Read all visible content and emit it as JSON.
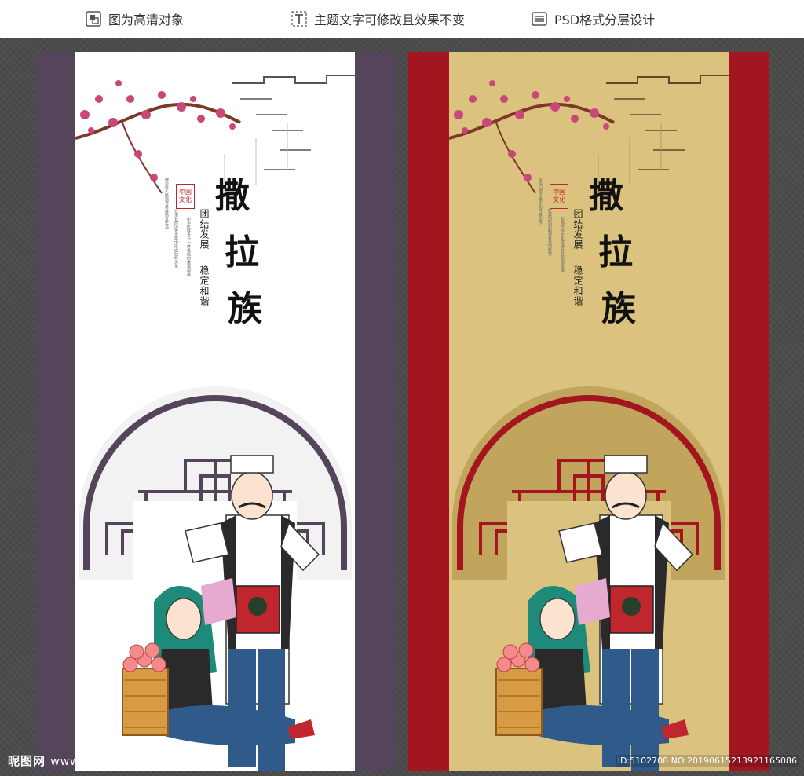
{
  "toolbar": {
    "item1": {
      "label": "图为高清对象",
      "icon": "image-icon"
    },
    "item2": {
      "label": "主题文字可修改且效果不变",
      "icon": "text-icon"
    },
    "item3": {
      "label": "PSD格式分层设计",
      "icon": "layers-icon"
    }
  },
  "poster": {
    "title_chars": [
      "撒",
      "拉",
      "族"
    ],
    "slogan_1": "团结发展",
    "slogan_2": "稳定和谐",
    "stamp_lines": [
      "中国",
      "文化"
    ],
    "body_columns": [
      "撒拉族人民勤劳勇敢热爱生活",
      "在漫长的历史发展中形成独特文化",
      "中华民族多元一体格局的重要组成",
      "风俗习惯丰富多彩传承至今",
      "民族团结和睦相处共同繁荣",
      "弘扬传统文化促进社会和谐发展"
    ]
  },
  "variants": [
    {
      "name": "white-purple",
      "bg": "#ffffff",
      "side": "#54455a",
      "arch": "#54455a",
      "arch_bg": "#f2f2f2"
    },
    {
      "name": "gold-red",
      "bg": "#dcc27f",
      "side": "#a3161f",
      "arch": "#a3161f",
      "arch_bg": "#c2a55c"
    }
  ],
  "watermark": {
    "brand": "昵图网",
    "url": "www.nipic.com",
    "id_text": "ID:5102708 NO:20190615213921165086"
  }
}
